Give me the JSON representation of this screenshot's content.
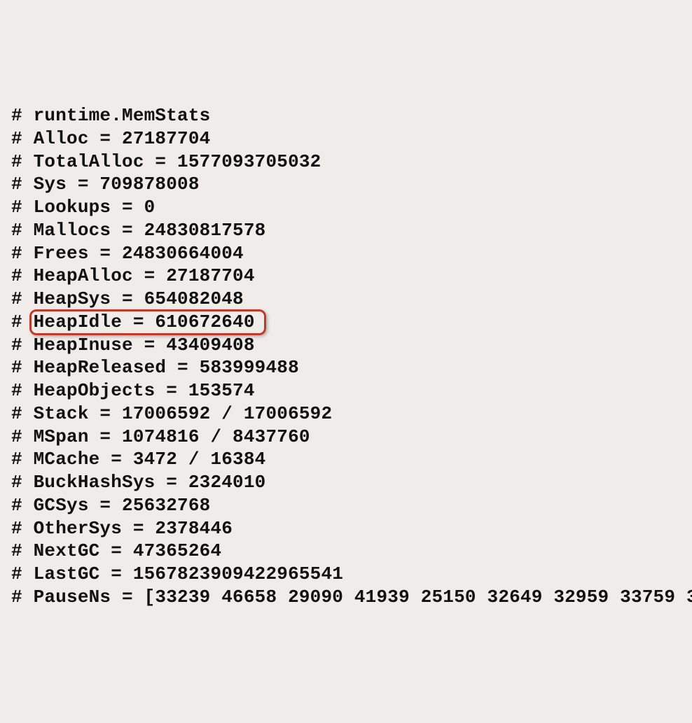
{
  "memstats": {
    "header": "runtime.MemStats",
    "lines": [
      {
        "key": "Alloc",
        "text": "Alloc = 27187704"
      },
      {
        "key": "TotalAlloc",
        "text": "TotalAlloc = 1577093705032"
      },
      {
        "key": "Sys",
        "text": "Sys = 709878008"
      },
      {
        "key": "Lookups",
        "text": "Lookups = 0"
      },
      {
        "key": "Mallocs",
        "text": "Mallocs = 24830817578"
      },
      {
        "key": "Frees",
        "text": "Frees = 24830664004"
      },
      {
        "key": "HeapAlloc",
        "text": "HeapAlloc = 27187704"
      },
      {
        "key": "HeapSys",
        "text": "HeapSys = 654082048"
      },
      {
        "key": "HeapIdle",
        "text": "HeapIdle = 610672640",
        "highlighted": true
      },
      {
        "key": "HeapInuse",
        "text": "HeapInuse = 43409408"
      },
      {
        "key": "HeapReleased",
        "text": "HeapReleased = 583999488"
      },
      {
        "key": "HeapObjects",
        "text": "HeapObjects = 153574"
      },
      {
        "key": "Stack",
        "text": "Stack = 17006592 / 17006592"
      },
      {
        "key": "MSpan",
        "text": "MSpan = 1074816 / 8437760"
      },
      {
        "key": "MCache",
        "text": "MCache = 3472 / 16384"
      },
      {
        "key": "BuckHashSys",
        "text": "BuckHashSys = 2324010"
      },
      {
        "key": "GCSys",
        "text": "GCSys = 25632768"
      },
      {
        "key": "OtherSys",
        "text": "OtherSys = 2378446"
      },
      {
        "key": "NextGC",
        "text": "NextGC = 47365264"
      },
      {
        "key": "LastGC",
        "text": "LastGC = 1567823909422965541"
      },
      {
        "key": "PauseNs",
        "text": "PauseNs = [33239 46658 29090 41939 25150 32649 32959 33759 3"
      }
    ],
    "hash": "# "
  }
}
